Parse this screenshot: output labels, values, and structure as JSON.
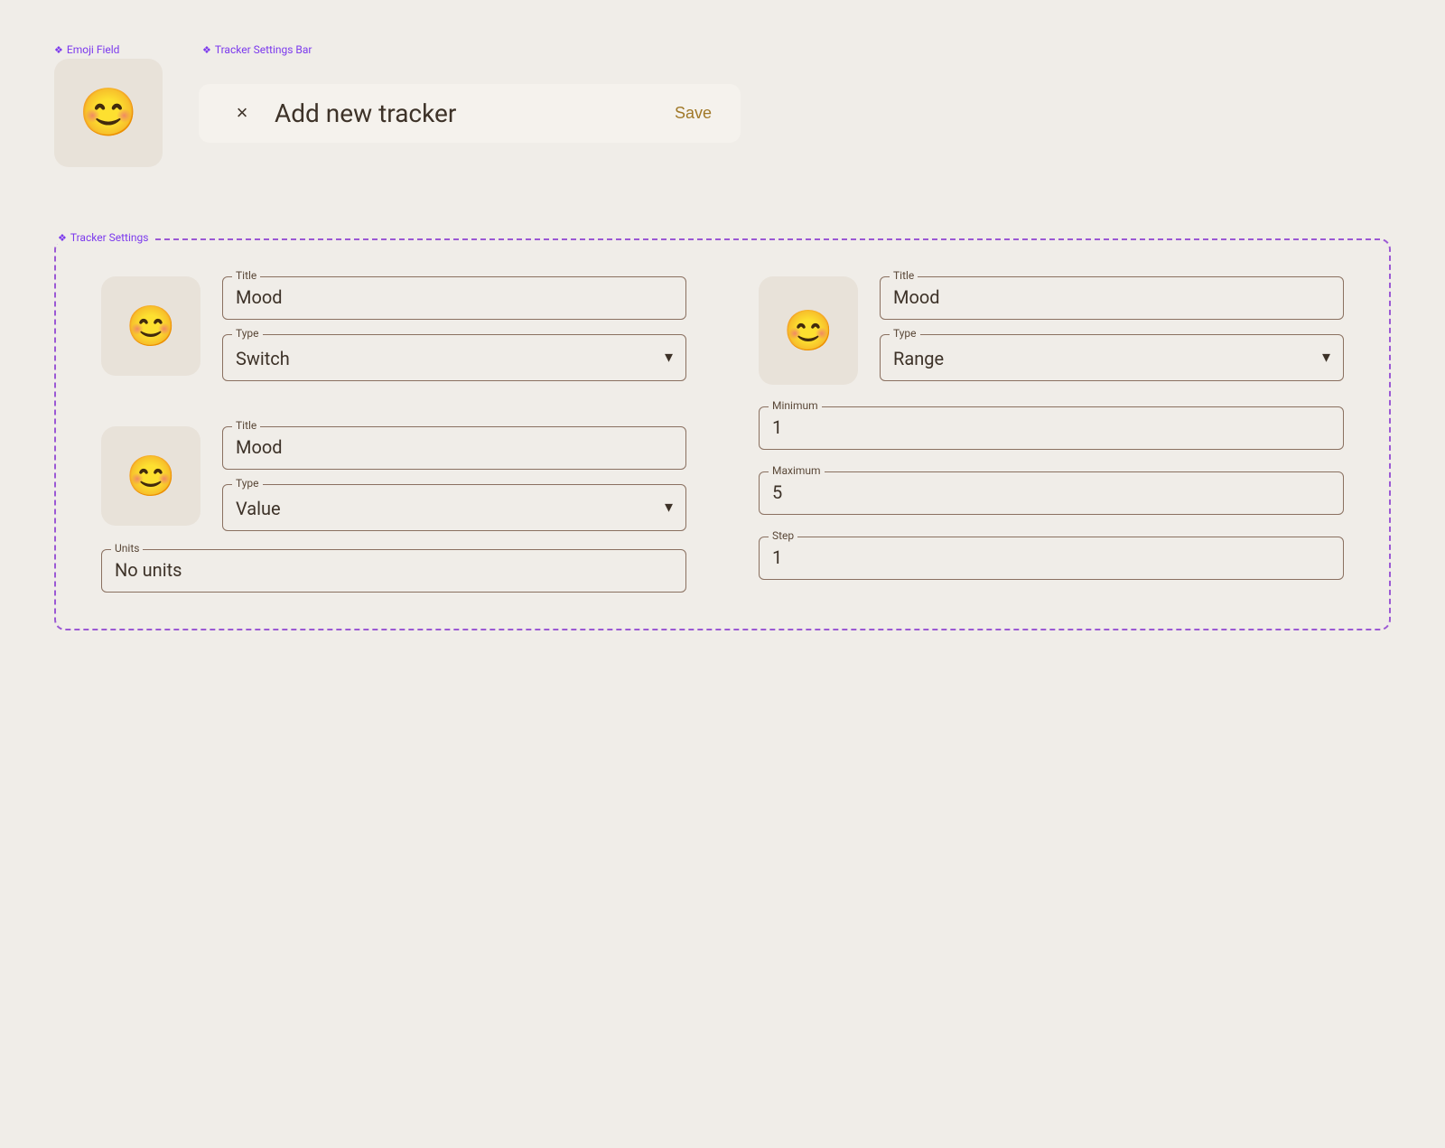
{
  "annotations": {
    "emoji_field_label": "Emoji Field",
    "tracker_settings_bar_label": "Tracker Settings Bar",
    "tracker_settings_label": "Tracker Settings"
  },
  "header": {
    "close_label": "×",
    "title": "Add new tracker",
    "save_label": "Save"
  },
  "emoji_field": {
    "emoji": "😊"
  },
  "tracker_settings": {
    "item1": {
      "emoji": "😊",
      "title_label": "Title",
      "title_value": "Mood",
      "type_label": "Type",
      "type_value": "Switch"
    },
    "item2": {
      "emoji": "😊",
      "title_label": "Title",
      "title_value": "Mood",
      "type_label": "Type",
      "type_value": "Value",
      "units_label": "Units",
      "units_value": "No units"
    },
    "item3": {
      "emoji": "😊",
      "title_label": "Title",
      "title_value": "Mood",
      "type_label": "Type",
      "type_value": "Range",
      "minimum_label": "Minimum",
      "minimum_value": "1",
      "maximum_label": "Maximum",
      "maximum_value": "5",
      "step_label": "Step",
      "step_value": "1"
    }
  }
}
